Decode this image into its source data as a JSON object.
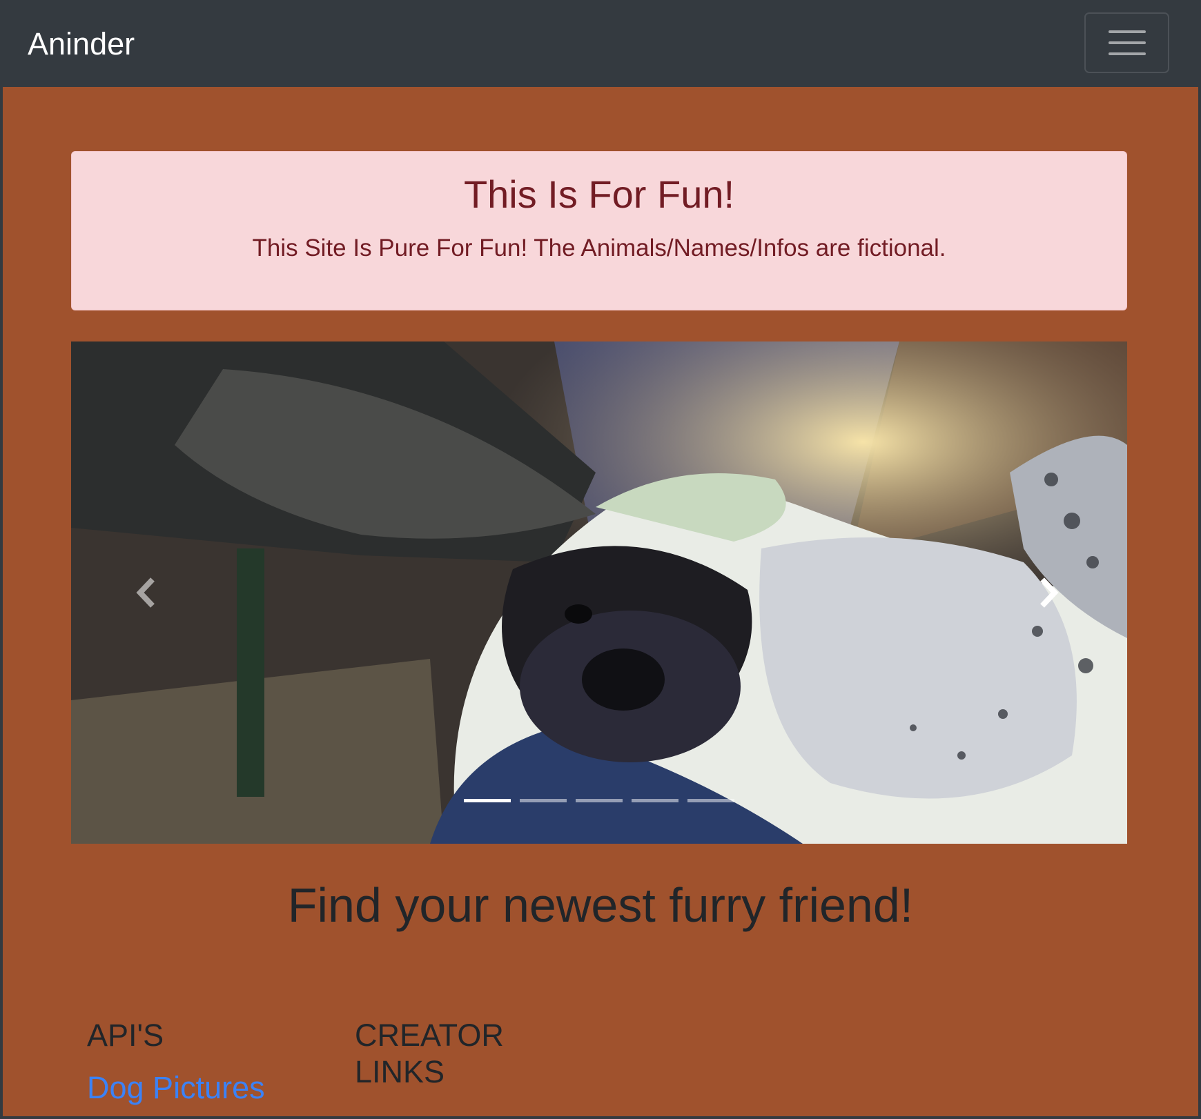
{
  "navbar": {
    "brand": "Aninder",
    "toggle_icon": "hamburger-icon"
  },
  "alert": {
    "title": "This Is For Fun!",
    "message": "This Site Is Pure For Fun! The Animals/Names/Infos are fictional."
  },
  "carousel": {
    "image_alt": "dog photo",
    "prev_icon": "chevron-left-icon",
    "next_icon": "chevron-right-icon",
    "slide_count": 5,
    "active_index": 0
  },
  "tagline": "Find your newest furry friend!",
  "footer": {
    "apis_heading": "API'S",
    "apis_links": [
      "Dog Pictures"
    ],
    "creator_heading": "CREATOR LINKS"
  },
  "colors": {
    "navbar_bg": "#343a40",
    "page_bg": "#a0522d",
    "alert_bg": "#f8d7da",
    "alert_text": "#721c24",
    "link": "#3b82f6"
  }
}
